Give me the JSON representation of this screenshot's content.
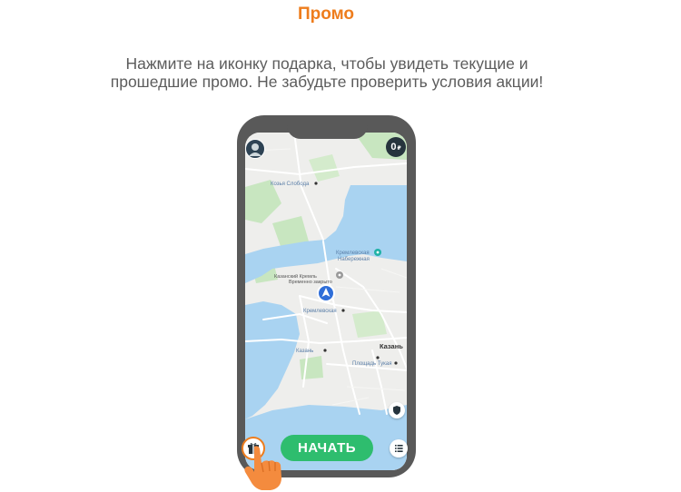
{
  "page": {
    "title": "Промо",
    "subtitle_line1": "Нажмите на иконку подарка, чтобы увидеть текущие и",
    "subtitle_line2": "прошедшие промо. Не забудьте проверить условия акции!"
  },
  "phone": {
    "balance": "0",
    "currency": "₽",
    "start_button": "НАЧАТЬ",
    "map_labels": {
      "kozya_sloboda": "Козья Слобода",
      "embankment_1": "Кремлевская",
      "embankment_2": "Набережная",
      "kremlin_1": "Казанский Кремль",
      "kremlin_2": "Временно закрыто",
      "kremlevskaya": "Кремлевская",
      "kazan_station": "Казань",
      "kazan_city": "Казань",
      "tukaya": "Площадь Тукая"
    },
    "icons": {
      "profile": "avatar-icon",
      "shield": "shield-icon",
      "list": "list-icon",
      "gift": "gift-icon",
      "hand": "pointing-hand-icon",
      "location": "location-arrow-icon"
    }
  },
  "colors": {
    "accent": "#ee7d1d",
    "start_button": "#2ebd6e",
    "phone_frame": "#595959",
    "water": "#a9d3f1",
    "park": "#c8e6c0",
    "location": "#2f6ed8"
  }
}
